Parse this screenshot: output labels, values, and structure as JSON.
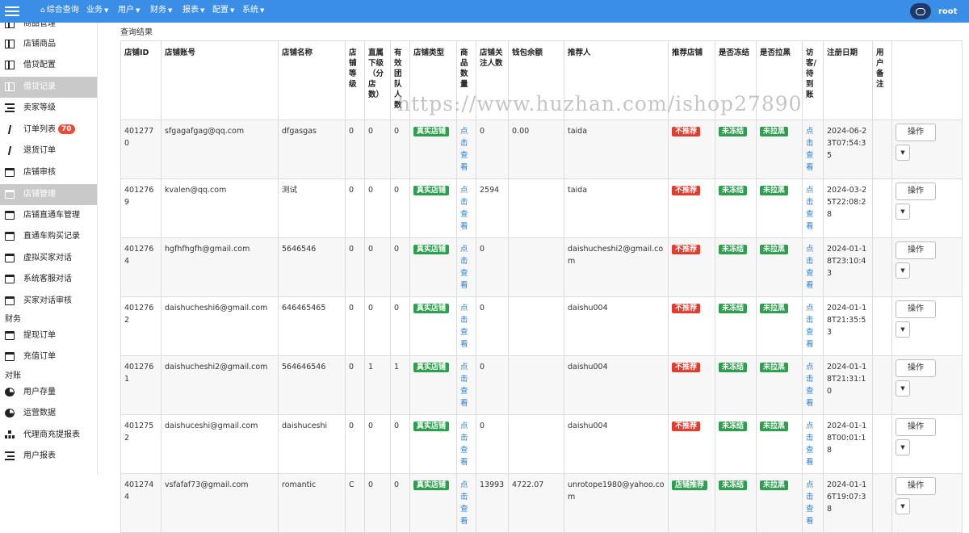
{
  "topnav": {
    "items": [
      {
        "label": "综合查询",
        "home": true,
        "caret": false
      },
      {
        "label": "业务",
        "caret": true
      },
      {
        "label": "用户",
        "caret": true
      },
      {
        "label": "财务",
        "caret": true
      },
      {
        "label": "报表",
        "caret": true
      },
      {
        "label": "配置",
        "caret": true
      },
      {
        "label": "系统",
        "caret": true
      }
    ],
    "user": "root"
  },
  "sidebar": {
    "items": [
      {
        "label": "商品管理",
        "icon": "grid-icon"
      },
      {
        "label": "店铺商品",
        "icon": "grid-icon"
      },
      {
        "label": "借贷配置",
        "icon": "grid-icon"
      },
      {
        "label": "借贷记录",
        "icon": "grid-icon",
        "active": true
      },
      {
        "label": "卖家等级",
        "icon": "list-icon"
      },
      {
        "label": "订单列表",
        "icon": "slash-icon",
        "badge": "70"
      },
      {
        "label": "退货订单",
        "icon": "slash-icon"
      },
      {
        "label": "店铺审核",
        "icon": "card-icon"
      },
      {
        "label": "店铺管理",
        "icon": "card-icon",
        "active": true
      },
      {
        "label": "店铺直通车管理",
        "icon": "card-icon"
      },
      {
        "label": "直通车购买记录",
        "icon": "card-icon"
      },
      {
        "label": "虚拟买家对话",
        "icon": "card-icon"
      },
      {
        "label": "系统客服对话",
        "icon": "card-icon"
      },
      {
        "label": "买家对话审核",
        "icon": "card-icon"
      },
      {
        "label": "提现订单",
        "icon": "card-icon"
      },
      {
        "label": "充值订单",
        "icon": "card-icon"
      },
      {
        "label": "用户存量",
        "icon": "pie-icon"
      },
      {
        "label": "运营数据",
        "icon": "pie-icon"
      },
      {
        "label": "代理商充提报表",
        "icon": "tree-icon"
      },
      {
        "label": "用户报表",
        "icon": "list-icon"
      }
    ],
    "sections": {
      "finance": "财务",
      "reconcile": "对账"
    }
  },
  "main": {
    "title": "查询结果",
    "watermark": "https://www.huzhan.com/ishop27890",
    "columns": [
      "店铺ID",
      "店铺账号",
      "店铺名称",
      "店铺等级",
      "直属下级（分店数）",
      "有效团队人数",
      "店铺类型",
      "商品数量",
      "店铺关注人数",
      "钱包余额",
      "推荐人",
      "推荐店铺",
      "是否冻结",
      "是否拉黑",
      "访客/待到账",
      "注册日期",
      "用户备注",
      ""
    ],
    "view_link": "点击查看",
    "op_label": "操作",
    "rows": [
      {
        "id": "4012770",
        "account": "sfgagafgag@qq.com",
        "name": "dfgasgas",
        "level": "0",
        "sub": "0",
        "team": "0",
        "type": "真实店铺",
        "goods": "点击查看",
        "follow": "0",
        "wallet": "0.00",
        "referrer": "taida",
        "recommend": "不推荐",
        "frozen": "未冻结",
        "black": "未拉黑",
        "visitor": "点击查看",
        "date": "2024-06-23T07:54:35",
        "note": ""
      },
      {
        "id": "4012769",
        "account": "kvalen@qq.com",
        "name": "测试",
        "level": "0",
        "sub": "0",
        "team": "0",
        "type": "真实店铺",
        "goods": "点击查看",
        "follow": "2594",
        "wallet": "",
        "referrer": "taida",
        "recommend": "不推荐",
        "frozen": "未冻结",
        "black": "未拉黑",
        "visitor": "点击查看",
        "date": "2024-03-25T22:08:28",
        "note": ""
      },
      {
        "id": "4012764",
        "account": "hgfhfhgfh@gmail.com",
        "name": "5646546",
        "level": "0",
        "sub": "0",
        "team": "0",
        "type": "真实店铺",
        "goods": "点击查看",
        "follow": "0",
        "wallet": "",
        "referrer": "daishucheshi2@gmail.com",
        "recommend": "不推荐",
        "frozen": "未冻结",
        "black": "未拉黑",
        "visitor": "点击查看",
        "date": "2024-01-18T23:10:43",
        "note": ""
      },
      {
        "id": "4012762",
        "account": "daishucheshi6@gmail.com",
        "name": "646465465",
        "level": "0",
        "sub": "0",
        "team": "0",
        "type": "真实店铺",
        "goods": "点击查看",
        "follow": "0",
        "wallet": "",
        "referrer": "daishu004",
        "recommend": "不推荐",
        "frozen": "未冻结",
        "black": "未拉黑",
        "visitor": "点击查看",
        "date": "2024-01-18T21:35:53",
        "note": ""
      },
      {
        "id": "4012761",
        "account": "daishucheshi2@gmail.com",
        "name": "564646546",
        "level": "0",
        "sub": "1",
        "team": "1",
        "type": "真实店铺",
        "goods": "点击查看",
        "follow": "0",
        "wallet": "",
        "referrer": "daishu004",
        "recommend": "不推荐",
        "frozen": "未冻结",
        "black": "未拉黑",
        "visitor": "点击查看",
        "date": "2024-01-18T21:31:10",
        "note": ""
      },
      {
        "id": "4012752",
        "account": "daishuceshi@gmail.com",
        "name": "daishuceshi",
        "level": "0",
        "sub": "0",
        "team": "0",
        "type": "真实店铺",
        "goods": "点击查看",
        "follow": "0",
        "wallet": "",
        "referrer": "daishu004",
        "recommend": "不推荐",
        "frozen": "未冻结",
        "black": "未拉黑",
        "visitor": "点击查看",
        "date": "2024-01-18T00:01:18",
        "note": ""
      },
      {
        "id": "4012744",
        "account": "vsfafaf73@gmail.com",
        "name": "romantic",
        "level": "C",
        "sub": "0",
        "team": "0",
        "type": "真实店铺",
        "goods": "点击查看",
        "follow": "13993",
        "wallet": "4722.07",
        "referrer": "unrotope1980@yahoo.com",
        "recommend": "店铺推荐",
        "frozen": "未冻结",
        "black": "未拉黑",
        "visitor": "点击查看",
        "date": "2024-01-16T19:07:38",
        "note": ""
      }
    ]
  },
  "colors": {
    "topbar": "#3a8ee6",
    "green": "#2e9e4f",
    "red": "#e13d2f",
    "link": "#2a7fd4",
    "badge": "#e74c3c"
  }
}
